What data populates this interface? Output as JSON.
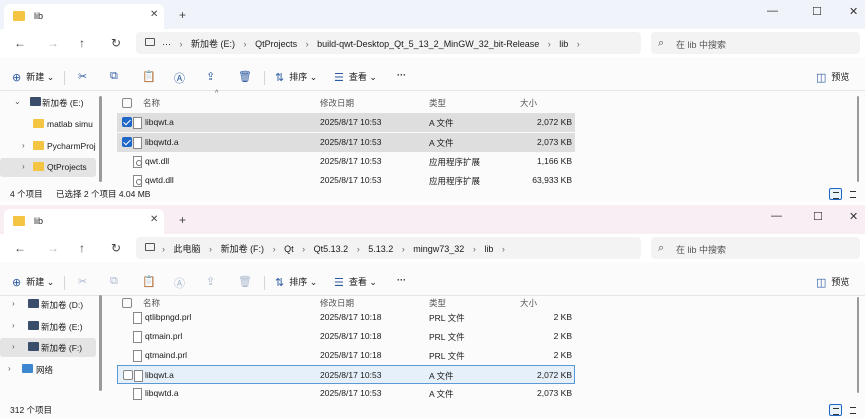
{
  "w1": {
    "tab_label": "lib",
    "crumbs": [
      "···",
      "新加卷 (E:)",
      "QtProjects",
      "build-qwt-Desktop_Qt_5_13_2_MinGW_32_bit-Release",
      "lib"
    ],
    "search_placeholder": "在 lib 中搜索",
    "nav_items": [
      {
        "label": "新加卷 (E:)",
        "kind": "drive",
        "expanded": true
      },
      {
        "label": "matlab simu",
        "kind": "folder"
      },
      {
        "label": "PycharmProj",
        "kind": "folder"
      },
      {
        "label": "QtProjects",
        "kind": "folder",
        "selected": true
      }
    ],
    "rows": [
      {
        "name": "libqwt.a",
        "date": "2025/8/17 10:53",
        "type": "A 文件",
        "size": "2,072 KB",
        "checked": true
      },
      {
        "name": "libqwtd.a",
        "date": "2025/8/17 10:53",
        "type": "A 文件",
        "size": "2,073 KB",
        "checked": true
      },
      {
        "name": "qwt.dll",
        "date": "2025/8/17 10:53",
        "type": "应用程序扩展",
        "size": "1,166 KB",
        "checked": false
      },
      {
        "name": "qwtd.dll",
        "date": "2025/8/17 10:53",
        "type": "应用程序扩展",
        "size": "63,933 KB",
        "checked": false
      }
    ],
    "status_count": "4 个项目",
    "status_selected": "已选择 2 个项目  4.04 MB"
  },
  "w2": {
    "tab_label": "lib",
    "crumbs": [
      "此电脑",
      "新加卷 (F:)",
      "Qt",
      "Qt5.13.2",
      "5.13.2",
      "mingw73_32",
      "lib"
    ],
    "search_placeholder": "在 lib 中搜索",
    "nav_items": [
      {
        "label": "新加卷 (D:)",
        "kind": "drive"
      },
      {
        "label": "新加卷 (E:)",
        "kind": "drive"
      },
      {
        "label": "新加卷 (F:)",
        "kind": "drive",
        "selected": true
      },
      {
        "label": "网络",
        "kind": "network"
      }
    ],
    "rows": [
      {
        "name": "qtlibpngd.prl",
        "date": "2025/8/17 10:18",
        "type": "PRL 文件",
        "size": "2 KB"
      },
      {
        "name": "qtmain.prl",
        "date": "2025/8/17 10:18",
        "type": "PRL 文件",
        "size": "2 KB"
      },
      {
        "name": "qtmaind.prl",
        "date": "2025/8/17 10:18",
        "type": "PRL 文件",
        "size": "2 KB"
      },
      {
        "name": "libqwt.a",
        "date": "2025/8/17 10:53",
        "type": "A 文件",
        "size": "2,072 KB",
        "focused": true
      },
      {
        "name": "libqwtd.a",
        "date": "2025/8/17 10:53",
        "type": "A 文件",
        "size": "2,073 KB"
      }
    ],
    "status_count": "312 个项目"
  },
  "toolbar": {
    "new_label": "新建",
    "sort_label": "排序",
    "view_label": "查看",
    "more_label": "···",
    "preview_label": "预览"
  },
  "columns": {
    "name": "名称",
    "date": "修改日期",
    "type": "类型",
    "size": "大小"
  },
  "colors": {
    "accent": "#1e66c8",
    "folder": "#f4c542"
  }
}
